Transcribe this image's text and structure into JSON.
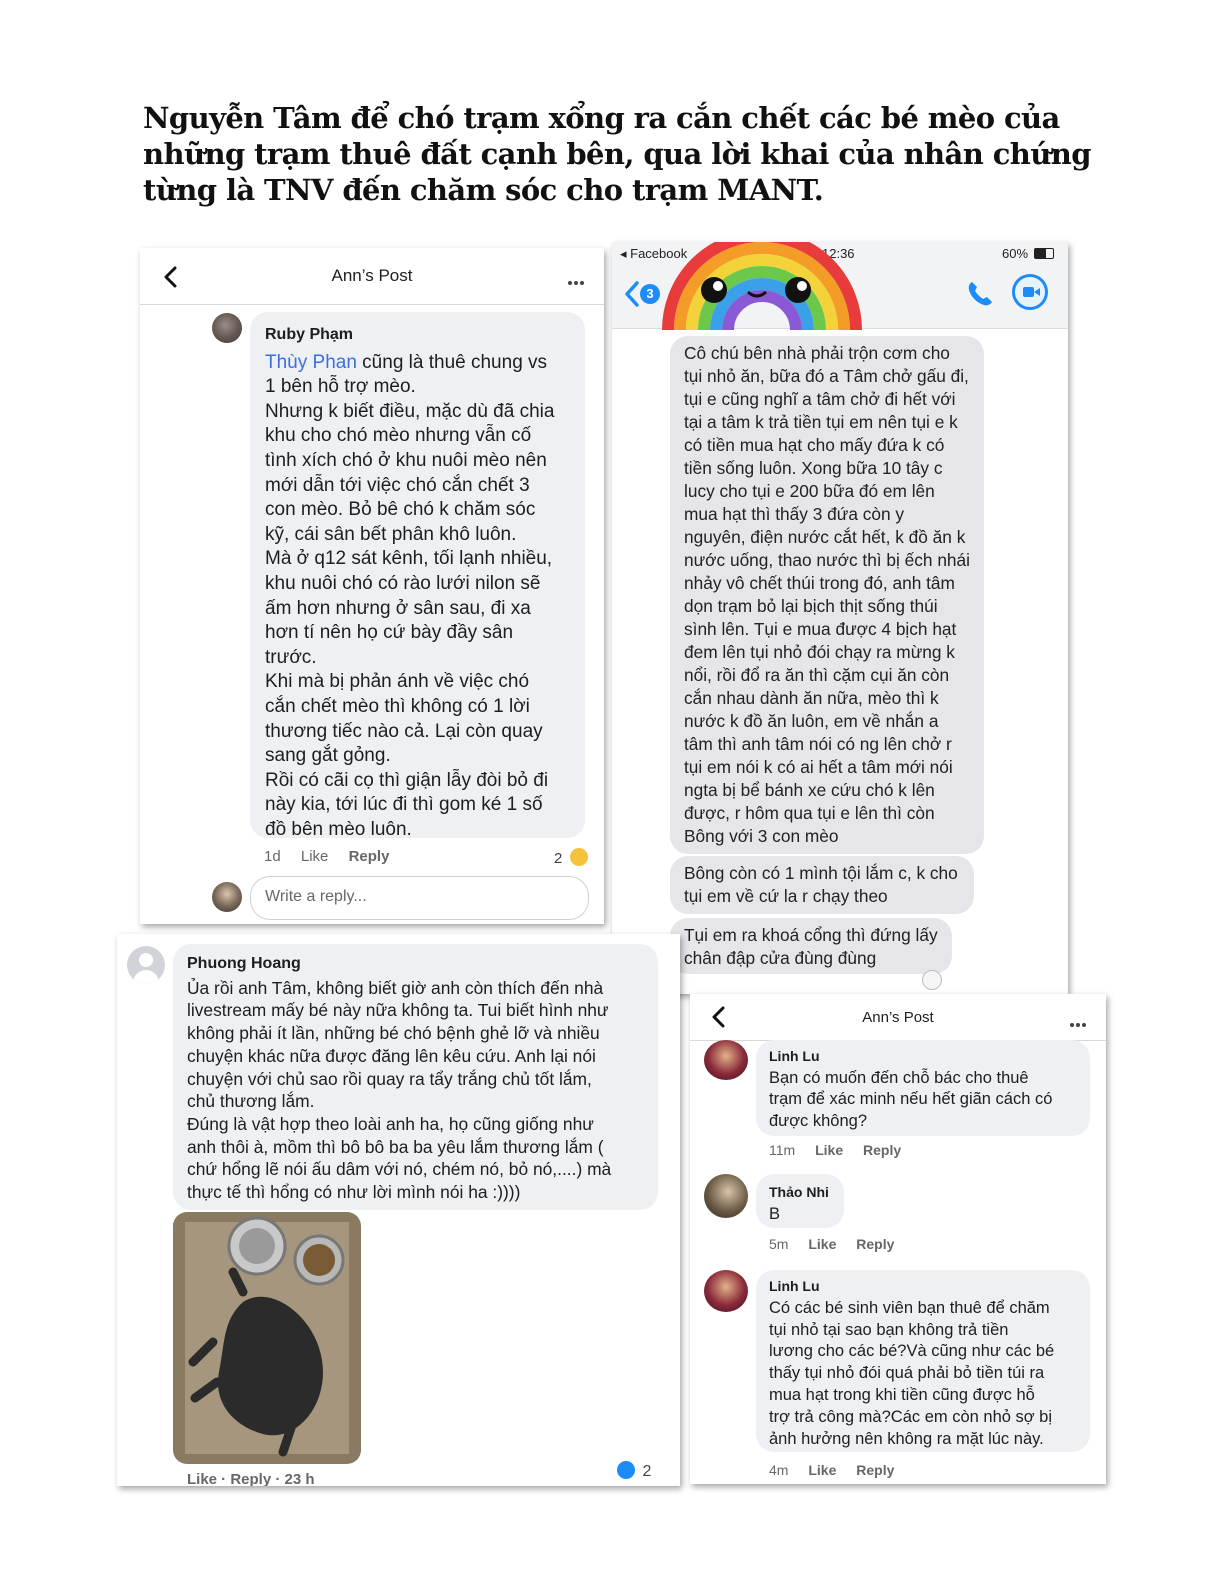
{
  "title_lines": [
    "Nguyễn Tâm để chó trạm xổng ra cắn chết các bé mèo của",
    "những trạm thuê đất cạnh bên, qua lời khai của nhân chứng",
    "từng là TNV đến chăm sóc cho trạm MANT."
  ],
  "panel1": {
    "header_title": "Ann’s Post",
    "comment": {
      "author": "Ruby Phạm",
      "mention": "Thùy Phan",
      "first_line_rest": " cũng là thuê chung vs",
      "lines": [
        "1 bên hỗ trợ mèo.",
        "Nhưng k biết điều, mặc dù đã chia",
        "khu cho chó mèo nhưng vẫn cố",
        "tình xích chó ở khu nuôi mèo nên",
        "mới dẫn tới việc chó cắn chết 3",
        "con mèo. Bỏ bê chó k chăm sóc",
        "kỹ, cái sân bết phân khô luôn.",
        "Mà ở q12 sát kênh, tối lạnh nhiều,",
        "khu nuôi chó có rào lưới nilon sẽ",
        "ấm hơn nhưng ở sân sau, đi xa",
        "hơn tí nên họ cứ bày đầy sân",
        "trước.",
        "Khi mà bị phản ánh về việc chó",
        "cắn chết mèo thì không có 1 lời",
        "thương tiếc nào cả. Lại còn quay",
        "sang gắt gỏng.",
        "Rồi có cãi cọ thì giận lẫy đòi bỏ đi",
        "này kia, tới lúc đi thì gom ké 1 số",
        "đồ bên mèo luôn."
      ],
      "time": "1d",
      "like": "Like",
      "reply": "Reply",
      "reaction_count": "2"
    },
    "reply_placeholder": "Write a reply..."
  },
  "panel2": {
    "status": {
      "app": "◂ Facebook",
      "time": "12:36",
      "battery": "60%"
    },
    "back_badge": "3",
    "messages": [
      {
        "lines": [
          "Cô chú bên nhà phải trộn cơm cho",
          "tụi nhỏ ăn, bữa đó a Tâm chở gấu đi,",
          "tụi e cũng nghĩ a tâm chở đi hết với",
          "tại a tâm k trả tiền tụi em nên tụi e k",
          "có tiền mua hạt cho mấy đứa k có",
          "tiền sống luôn. Xong bữa 10 tây c",
          "lucy cho tụi e 200 bữa đó em lên",
          "mua hạt thì thấy 3 đứa còn y",
          "nguyên, điện nước cắt hết, k đồ ăn k",
          "nước uống, thao nước thì bị ếch nhái",
          "nhảy vô chết thúi trong đó, anh tâm",
          "dọn trạm bỏ lại bịch thịt sống thúi",
          "sình lên. Tụi e mua được 4 bịch hạt",
          "đem lên tụi nhỏ đói chạy ra mừng k",
          "nổi, rồi đổ ra ăn thì cặm cụi ăn còn",
          "cắn nhau dành ăn nữa, mèo thì k",
          "nước k đồ ăn luôn, em về nhắn a",
          "tâm thì anh tâm nói có ng lên chở r",
          "tụi em nói k có ai hết a tâm mới nói",
          "ngta bị bể bánh xe cứu chó k lên",
          "được, r hôm qua tụi e lên thì còn",
          "Bông với 3 con mèo"
        ]
      },
      {
        "lines": [
          "Bông còn có 1 mình tội lắm c, k cho",
          "tụi em về cứ la r chạy theo"
        ]
      },
      {
        "lines": [
          "Tụi em ra khoá cổng thì đứng lấy",
          "chân đập cửa đùng đùng"
        ]
      }
    ]
  },
  "panel3": {
    "comment": {
      "author": "Phuong Hoang",
      "lines": [
        "Ủa rồi anh Tâm, không biết giờ anh còn thích đến nhà",
        "livestream mấy bé này nữa không ta. Tui biết hình như",
        "không phải ít lần, những bé chó bệnh ghẻ lỡ và nhiều",
        "chuyện khác nữa được đăng lên kêu cứu. Anh lại nói",
        "chuyện với chủ sao rồi quay ra tẩy trắng chủ tốt lắm,",
        "chủ thương lắm.",
        "Đúng là vật hợp theo loài anh ha, họ cũng giống như",
        "anh thôi à, mồm thì bô bô ba ba yêu lắm thương lắm (",
        "chứ hổng lẽ nói ấu dâm với nó, chém nó, bỏ nó,....) mà",
        "thực tế thì hổng có như lời mình nói ha :))))"
      ]
    },
    "meta": "Like · Reply · 23 h",
    "reaction_count": "2"
  },
  "panel4": {
    "header_title": "Ann’s Post",
    "comments": [
      {
        "author": "Linh Lu",
        "lines": [
          "Bạn có muốn đến chỗ bác cho thuê",
          "trạm để xác minh nếu hết giãn cách có",
          "được không?"
        ],
        "time": "11m"
      },
      {
        "author": "Thảo Nhi",
        "lines": [
          "B"
        ],
        "time": "5m"
      },
      {
        "author": "Linh Lu",
        "lines": [
          "Có các bé sinh viên bạn thuê để chăm",
          "tụi nhỏ tại sao bạn không trả tiền",
          "lương cho các bé?Và cũng như các bé",
          "thấy tụi nhỏ đói quá phải bỏ tiền túi ra",
          "mua hạt trong khi tiền cũng được hỗ",
          "trợ trả công mà?Các em còn nhỏ sợ bị",
          "ảnh hưởng nên không ra mặt lúc này."
        ],
        "time": "4m"
      }
    ],
    "like": "Like",
    "reply": "Reply"
  },
  "colors": {
    "link": "#3b6fe0",
    "bubble": "#eef0f3",
    "messenger_blue": "#1d8cf8"
  }
}
